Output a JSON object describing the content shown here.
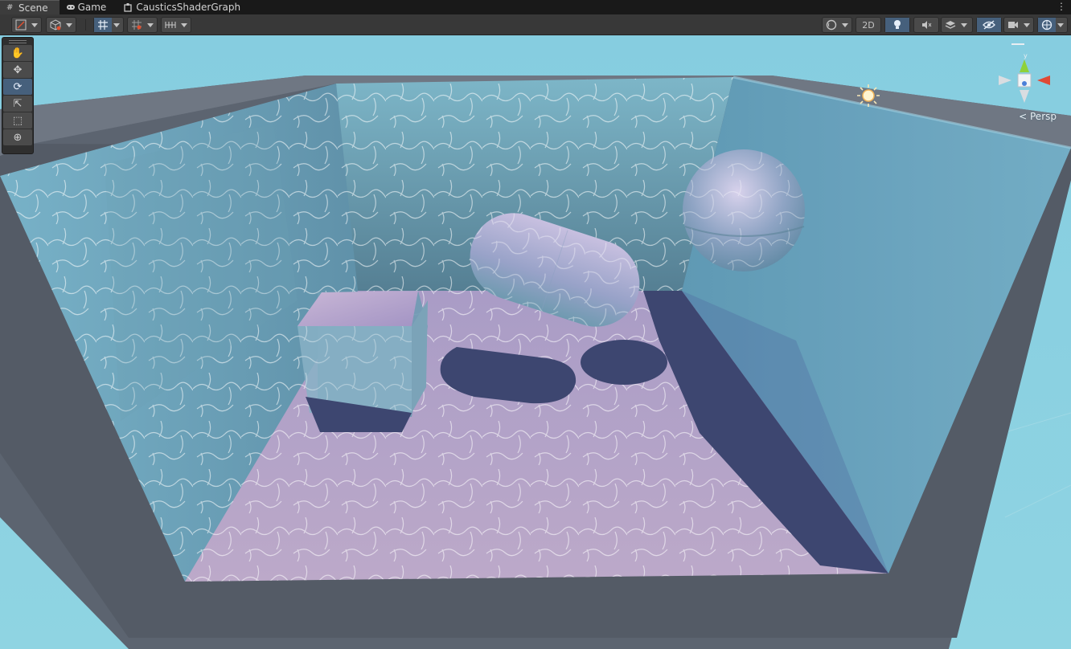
{
  "tabs": [
    {
      "label": "Scene",
      "icon": "grid-icon",
      "active": true
    },
    {
      "label": "Game",
      "icon": "gamepad-icon",
      "active": false
    },
    {
      "label": "CausticsShaderGraph",
      "icon": "graph-icon",
      "active": false
    }
  ],
  "toolbar": {
    "draw_mode_icon": "shading-icon",
    "view_2d_label": "2D",
    "accent": "#46607c"
  },
  "tools": [
    {
      "name": "hand-tool",
      "icon": "hand-icon",
      "glyph": "✋",
      "active": false
    },
    {
      "name": "move-tool",
      "icon": "move-icon",
      "glyph": "✥",
      "active": false
    },
    {
      "name": "rotate-tool",
      "icon": "rotate-icon",
      "glyph": "⟳",
      "active": true
    },
    {
      "name": "scale-tool",
      "icon": "scale-icon",
      "glyph": "⇱",
      "active": false
    },
    {
      "name": "rect-tool",
      "icon": "rect-icon",
      "glyph": "⬚",
      "active": false
    },
    {
      "name": "transform-tool",
      "icon": "transform-icon",
      "glyph": "⊕",
      "active": false
    }
  ],
  "gizmo": {
    "projection_label": "Persp",
    "axis_y_label": "y",
    "colors": {
      "x": "#e04a35",
      "y": "#8fd13a",
      "z": "#4a7fd8"
    }
  },
  "scene": {
    "sky_color": "#8fd1df",
    "floor_color": "#b9a9c8",
    "shadow_color": "#3d4670",
    "frame_color": "#5d6570"
  }
}
